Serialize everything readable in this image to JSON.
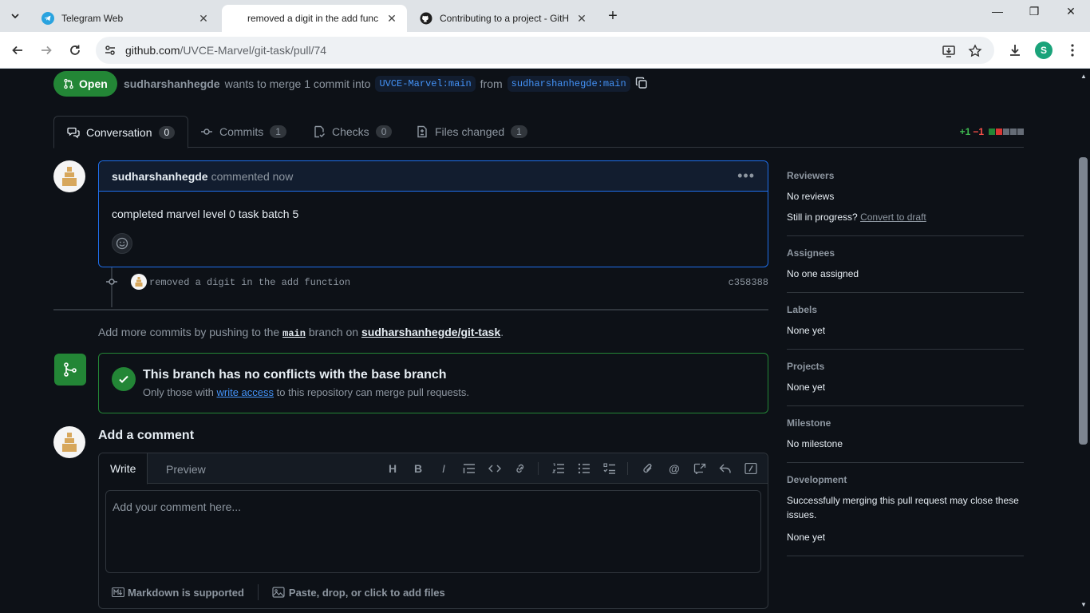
{
  "browser": {
    "tabs": [
      {
        "title": "Telegram Web",
        "active": false
      },
      {
        "title": "removed a digit in the add func",
        "active": true
      },
      {
        "title": "Contributing to a project - GitH",
        "active": false
      }
    ],
    "url_host": "github.com",
    "url_path": "/UVCE-Marvel/git-task/pull/74",
    "profile_initial": "S"
  },
  "pr": {
    "state": "Open",
    "author": "sudharshanhegde",
    "merge_text": "wants to merge 1 commit into",
    "base_branch": "UVCE-Marvel:main",
    "from_text": "from",
    "head_branch": "sudharshanhegde:main",
    "tabs": [
      {
        "label": "Conversation",
        "count": "0"
      },
      {
        "label": "Commits",
        "count": "1"
      },
      {
        "label": "Checks",
        "count": "0"
      },
      {
        "label": "Files changed",
        "count": "1"
      }
    ],
    "additions": "+1",
    "deletions": "−1"
  },
  "comment": {
    "author": "sudharshanhegde",
    "time": "commented now",
    "body": "completed marvel level 0 task batch 5"
  },
  "commit": {
    "message": "removed a digit in the add function",
    "sha": "c358388"
  },
  "push_note": {
    "prefix": "Add more commits by pushing to the",
    "branch": "main",
    "middle": "branch on",
    "repo": "sudharshanhegde/git-task",
    "suffix": "."
  },
  "merge": {
    "title": "This branch has no conflicts with the base branch",
    "sub_prefix": "Only those with",
    "sub_link": "write access",
    "sub_suffix": "to this repository can merge pull requests."
  },
  "add_comment": {
    "heading": "Add a comment",
    "tab_write": "Write",
    "tab_preview": "Preview",
    "placeholder": "Add your comment here...",
    "markdown_note": "Markdown is supported",
    "attach_note": "Paste, drop, or click to add files"
  },
  "sidebar": {
    "reviewers_h": "Reviewers",
    "reviewers_v": "No reviews",
    "progress_q": "Still in progress?",
    "progress_link": "Convert to draft",
    "assignees_h": "Assignees",
    "assignees_v": "No one assigned",
    "labels_h": "Labels",
    "labels_v": "None yet",
    "projects_h": "Projects",
    "projects_v": "None yet",
    "milestone_h": "Milestone",
    "milestone_v": "No milestone",
    "development_h": "Development",
    "development_v": "Successfully merging this pull request may close these issues.",
    "development_v2": "None yet"
  },
  "colors": {
    "green": "#238636",
    "accent": "#4493f8",
    "bg": "#0d1117"
  }
}
